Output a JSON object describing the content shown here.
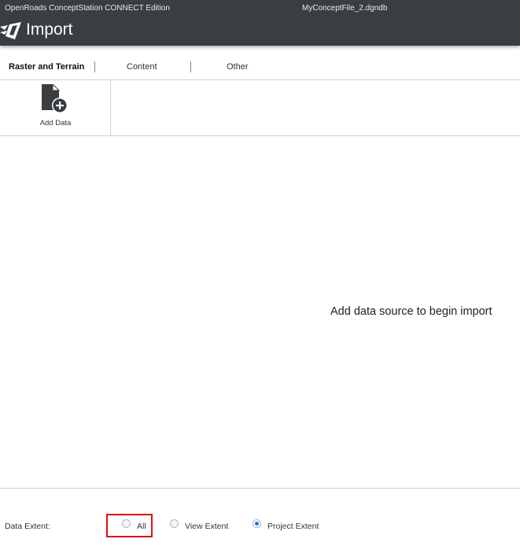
{
  "titlebar": {
    "app_name": "OpenRoads ConceptStation CONNECT Edition",
    "file_name": "MyConceptFile_2.dgndb",
    "page_title": "Import",
    "logo_icon": "road-logo-icon"
  },
  "tabs": [
    {
      "label": "Raster and Terrain",
      "active": true
    },
    {
      "label": "Content",
      "active": false
    },
    {
      "label": "Other",
      "active": false
    }
  ],
  "ribbon": {
    "add_data_label": "Add Data",
    "add_data_icon": "file-add-icon"
  },
  "main": {
    "empty_message": "Add data source to begin import"
  },
  "data_extent": {
    "label": "Data Extent:",
    "options": [
      {
        "label": "All",
        "selected": false,
        "highlighted": true
      },
      {
        "label": "View Extent",
        "selected": false
      },
      {
        "label": "Project Extent",
        "selected": true
      }
    ]
  },
  "colors": {
    "titlebar_bg": "#3a3e42",
    "radio_selected": "#1f7ae0",
    "highlight": "#e01010"
  }
}
